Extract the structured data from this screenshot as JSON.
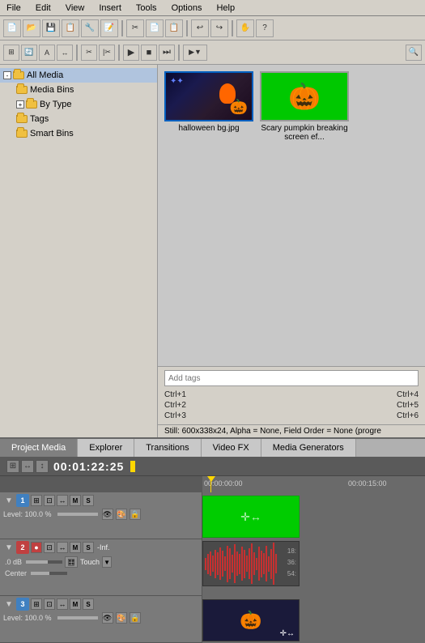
{
  "menu": {
    "items": [
      "File",
      "Edit",
      "View",
      "Insert",
      "Tools",
      "Options",
      "Help"
    ]
  },
  "toolbar1": {
    "buttons": [
      "new",
      "open",
      "save",
      "save-as",
      "prop",
      "script",
      "undo",
      "redo",
      "hand",
      "help"
    ]
  },
  "toolbar2": {
    "buttons": [
      "snap",
      "loop",
      "auto",
      "split",
      "cut",
      "copy",
      "paste",
      "play",
      "stop",
      "next",
      "transport",
      "search"
    ]
  },
  "sidebar": {
    "items": [
      {
        "label": "All Media",
        "level": 0,
        "expanded": true,
        "selected": true
      },
      {
        "label": "Media Bins",
        "level": 1
      },
      {
        "label": "By Type",
        "level": 1,
        "expandable": true
      },
      {
        "label": "Tags",
        "level": 1
      },
      {
        "label": "Smart Bins",
        "level": 1
      }
    ]
  },
  "media_items": [
    {
      "name": "halloween bg.jpg",
      "type": "halloween"
    },
    {
      "name": "Scary pumpkin breaking screen ef...",
      "type": "pumpkin"
    }
  ],
  "info": {
    "tags_placeholder": "Add tags",
    "shortcuts": [
      {
        "left": "Ctrl+1",
        "right": "Ctrl+4"
      },
      {
        "left": "Ctrl+2",
        "right": "Ctrl+5"
      },
      {
        "left": "Ctrl+3",
        "right": "Ctrl+6"
      }
    ],
    "status": "Still: 600x338x24, Alpha = None, Field Order = None (progre"
  },
  "tabs": {
    "items": [
      "Project Media",
      "Explorer",
      "Transitions",
      "Video FX",
      "Media Generators"
    ],
    "active": 0
  },
  "timeline": {
    "timecode": "00:01:22:25",
    "ruler": {
      "start": "00:00:00:00",
      "mid": "00:00:15:00"
    },
    "tracks": [
      {
        "num": "1",
        "color": "blue",
        "level": "Level: 100.0 %",
        "type": "video",
        "clip_type": "green"
      },
      {
        "num": "2",
        "color": "red",
        "level": ".0 dB",
        "pan": "Center",
        "type": "audio",
        "extra": "-Inf.",
        "clip_type": "audio"
      },
      {
        "num": "3",
        "color": "blue",
        "level": "Level: 100.0 %",
        "type": "video",
        "clip_type": "halloween"
      }
    ]
  }
}
